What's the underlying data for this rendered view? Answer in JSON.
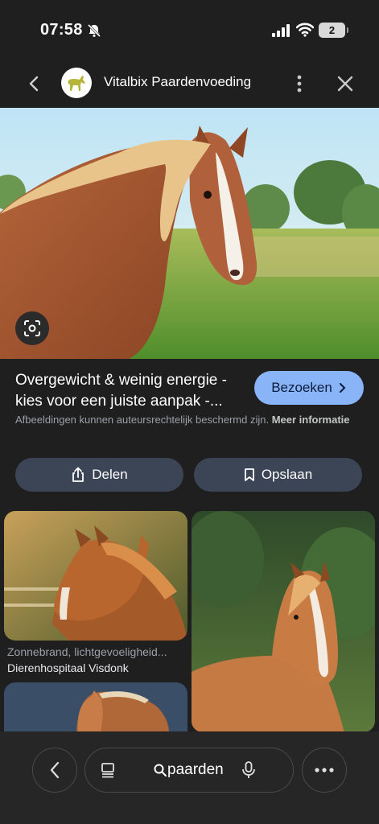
{
  "status_bar": {
    "time": "07:58",
    "battery_level": "2"
  },
  "header": {
    "site_name": "Vitalbix Paardenvoeding"
  },
  "result": {
    "title": "Overgewicht & weinig energie - kies voor een juiste aanpak -...",
    "visit_label": "Bezoeken",
    "copyright_text": "Afbeeldingen kunnen auteursrechtelijk beschermd zijn.",
    "more_info_label": "Meer informatie"
  },
  "actions": {
    "share_label": "Delen",
    "save_label": "Opslaan"
  },
  "related": [
    {
      "title": "Zonnebrand, lichtgevoeligheid...",
      "source": "Dierenhospitaal Visdonk"
    }
  ],
  "bottom_bar": {
    "search_query": "paarden"
  },
  "colors": {
    "background": "#1f1f1f",
    "accent": "#8ab4f8",
    "button": "#3c4556"
  },
  "icons": [
    "bell-off-icon",
    "signal-icon",
    "wifi-icon",
    "back-arrow-icon",
    "horse-logo-icon",
    "more-vert-icon",
    "close-icon",
    "lens-icon",
    "chevron-right-icon",
    "share-icon",
    "bookmark-icon",
    "tabs-icon",
    "search-icon",
    "mic-icon",
    "more-horiz-icon"
  ]
}
